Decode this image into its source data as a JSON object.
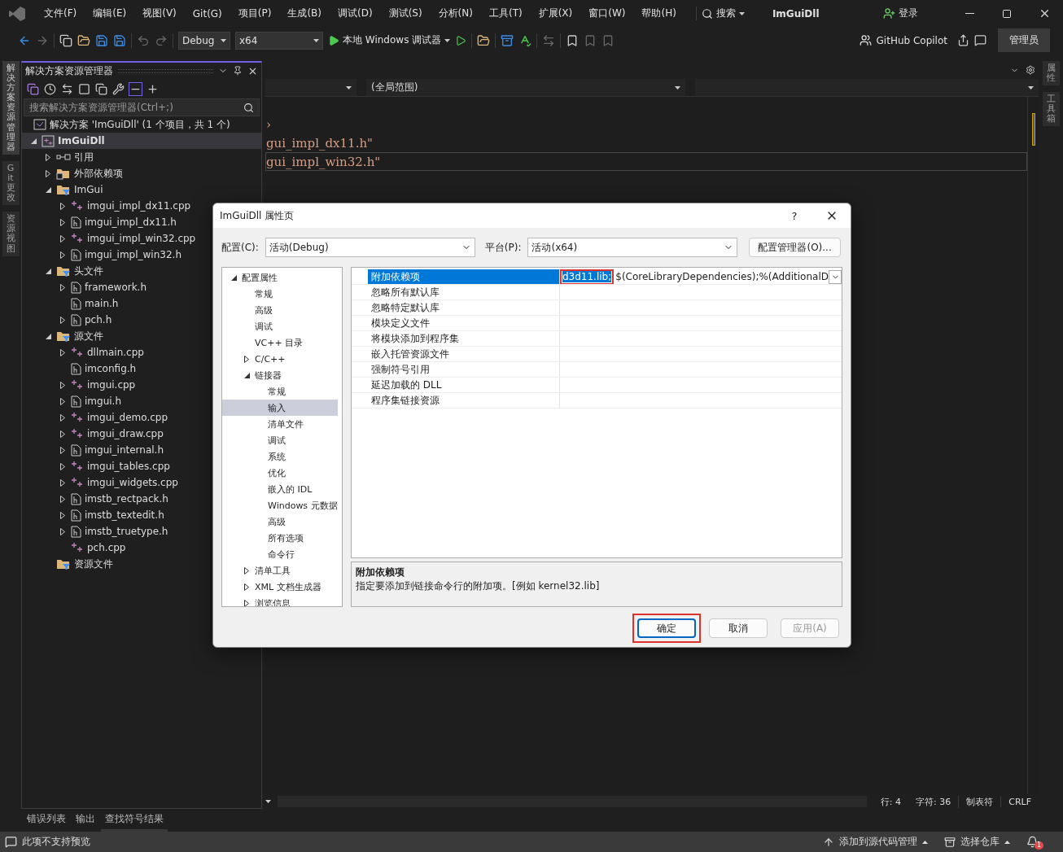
{
  "title_bar": {
    "menus": [
      "文件(F)",
      "编辑(E)",
      "视图(V)",
      "Git(G)",
      "项目(P)",
      "生成(B)",
      "调试(D)",
      "测试(S)",
      "分析(N)",
      "工具(T)",
      "扩展(X)",
      "窗口(W)",
      "帮助(H)"
    ],
    "search": "搜索",
    "title": "ImGuiDll",
    "sign_in": "登录"
  },
  "toolbar": {
    "configuration": "Debug",
    "platform": "x64",
    "run": "本地 Windows 调试器",
    "copilot": "GitHub Copilot",
    "admin": "管理员"
  },
  "left_tabs": [
    {
      "label": "解决方案资源管理器",
      "selected": true
    },
    {
      "label": "Git 更改",
      "selected": false
    },
    {
      "label": "资源视图",
      "selected": false
    }
  ],
  "right_tabs": [
    {
      "label": "属性",
      "selected": false
    },
    {
      "label": "工具箱",
      "selected": false
    }
  ],
  "explorer": {
    "title": "解决方案资源管理器",
    "search_placeholder": "搜索解决方案资源管理器(Ctrl+;)",
    "solution": "解决方案 'ImGuiDll' (1 个项目，共 1 个)",
    "tree": [
      {
        "label": "ImGuiDll",
        "kind": "project",
        "expanded": true,
        "selected": true,
        "children": [
          {
            "label": "引用",
            "kind": "references",
            "expanded": false,
            "selected": false
          },
          {
            "label": "外部依赖项",
            "kind": "external",
            "expanded": false,
            "selected": false
          },
          {
            "label": "ImGui",
            "kind": "filter",
            "expanded": true,
            "selected": false,
            "children": [
              {
                "label": "imgui_impl_dx11.cpp",
                "kind": "cpp",
                "expanded": false,
                "selected": false
              },
              {
                "label": "imgui_impl_dx11.h",
                "kind": "h",
                "expanded": false,
                "selected": false
              },
              {
                "label": "imgui_impl_win32.cpp",
                "kind": "cpp",
                "expanded": false,
                "selected": false
              },
              {
                "label": "imgui_impl_win32.h",
                "kind": "h",
                "expanded": false,
                "selected": false
              }
            ]
          },
          {
            "label": "头文件",
            "kind": "filter",
            "expanded": true,
            "selected": false,
            "children": [
              {
                "label": "framework.h",
                "kind": "h",
                "expanded": false,
                "selected": false
              },
              {
                "label": "main.h",
                "kind": "h",
                "selected": false
              },
              {
                "label": "pch.h",
                "kind": "h",
                "expanded": false,
                "selected": false
              }
            ]
          },
          {
            "label": "源文件",
            "kind": "filter",
            "expanded": true,
            "selected": false,
            "children": [
              {
                "label": "dllmain.cpp",
                "kind": "cpp",
                "expanded": false,
                "selected": false
              },
              {
                "label": "imconfig.h",
                "kind": "h",
                "selected": false
              },
              {
                "label": "imgui.cpp",
                "kind": "cpp",
                "expanded": false,
                "selected": false
              },
              {
                "label": "imgui.h",
                "kind": "h",
                "expanded": false,
                "selected": false
              },
              {
                "label": "imgui_demo.cpp",
                "kind": "cpp",
                "expanded": false,
                "selected": false
              },
              {
                "label": "imgui_draw.cpp",
                "kind": "cpp",
                "expanded": false,
                "selected": false
              },
              {
                "label": "imgui_internal.h",
                "kind": "h",
                "expanded": false,
                "selected": false
              },
              {
                "label": "imgui_tables.cpp",
                "kind": "cpp",
                "expanded": false,
                "selected": false
              },
              {
                "label": "imgui_widgets.cpp",
                "kind": "cpp",
                "expanded": false,
                "selected": false
              },
              {
                "label": "imstb_rectpack.h",
                "kind": "h",
                "expanded": false,
                "selected": false
              },
              {
                "label": "imstb_textedit.h",
                "kind": "h",
                "expanded": false,
                "selected": false
              },
              {
                "label": "imstb_truetype.h",
                "kind": "h",
                "expanded": false,
                "selected": false
              },
              {
                "label": "pch.cpp",
                "kind": "cpp",
                "selected": false
              }
            ]
          },
          {
            "label": "资源文件",
            "kind": "filter",
            "selected": false
          }
        ]
      }
    ]
  },
  "editor": {
    "scope": "(全局范围)",
    "code_lines": [
      {
        "text": "›",
        "current": false
      },
      {
        "text": "gui_impl_dx11.h\"",
        "current": false
      },
      {
        "text": "gui_impl_win32.h\"",
        "current": true
      }
    ],
    "status": {
      "line": "行: 4",
      "char": "字符: 36",
      "tabs": "制表符",
      "eol": "CRLF"
    }
  },
  "bottom_tabs": [
    {
      "label": "错误列表",
      "selected": false
    },
    {
      "label": "输出",
      "selected": false
    },
    {
      "label": "查找符号结果",
      "selected": true
    }
  ],
  "status_bar": {
    "message": "此项不支持预览",
    "source_control": "添加到源代码管理",
    "repository": "选择仓库",
    "notifications": "1"
  },
  "dialog": {
    "title": "ImGuiDll 属性页",
    "help": "?",
    "config_label": "配置(C):",
    "config_value": "活动(Debug)",
    "platform_label": "平台(P):",
    "platform_value": "活动(x64)",
    "manager_button": "配置管理器(O)...",
    "tree": [
      {
        "label": "配置属性",
        "expanded": true,
        "selected": false,
        "children": [
          {
            "label": "常规",
            "selected": false
          },
          {
            "label": "高级",
            "selected": false
          },
          {
            "label": "调试",
            "selected": false
          },
          {
            "label": "VC++ 目录",
            "selected": false
          },
          {
            "label": "C/C++",
            "expanded": false,
            "selected": false
          },
          {
            "label": "链接器",
            "expanded": true,
            "selected": false,
            "children": [
              {
                "label": "常规",
                "selected": false
              },
              {
                "label": "输入",
                "selected": true
              },
              {
                "label": "清单文件",
                "selected": false
              },
              {
                "label": "调试",
                "selected": false
              },
              {
                "label": "系统",
                "selected": false
              },
              {
                "label": "优化",
                "selected": false
              },
              {
                "label": "嵌入的 IDL",
                "selected": false
              },
              {
                "label": "Windows 元数据",
                "selected": false
              },
              {
                "label": "高级",
                "selected": false
              },
              {
                "label": "所有选项",
                "selected": false
              },
              {
                "label": "命令行",
                "selected": false
              }
            ]
          },
          {
            "label": "清单工具",
            "expanded": false,
            "selected": false
          },
          {
            "label": "XML 文档生成器",
            "expanded": false,
            "selected": false
          },
          {
            "label": "浏览信息",
            "expanded": false,
            "selected": false
          }
        ]
      }
    ],
    "properties": [
      {
        "name": "附加依赖项",
        "selected": true,
        "value_selected": "d3d11.lib;",
        "value": "$(CoreLibraryDependencies);%(AdditionalD",
        "highlighted": true
      },
      {
        "name": "忽略所有默认库",
        "selected": false
      },
      {
        "name": "忽略特定默认库",
        "selected": false
      },
      {
        "name": "模块定义文件",
        "selected": false
      },
      {
        "name": "将模块添加到程序集",
        "selected": false
      },
      {
        "name": "嵌入托管资源文件",
        "selected": false
      },
      {
        "name": "强制符号引用",
        "selected": false
      },
      {
        "name": "延迟加载的 DLL",
        "selected": false
      },
      {
        "name": "程序集链接资源",
        "selected": false
      }
    ],
    "description": {
      "title": "附加依赖项",
      "text": "指定要添加到链接命令行的附加项。[例如 kernel32.lib]"
    },
    "buttons": [
      {
        "label": "确定",
        "kind": "default",
        "disabled": false,
        "highlighted": true
      },
      {
        "label": "取消",
        "kind": "normal",
        "disabled": false
      },
      {
        "label": "应用(A)",
        "kind": "normal",
        "disabled": true
      }
    ]
  }
}
